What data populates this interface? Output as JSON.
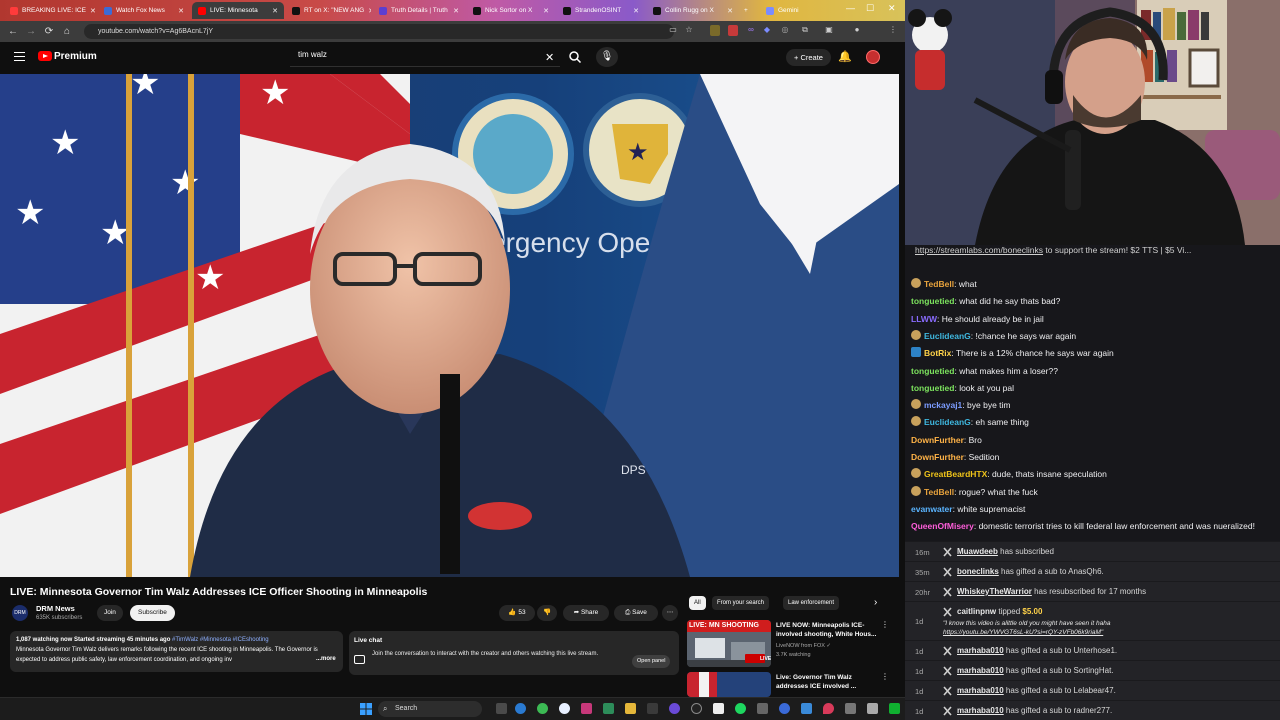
{
  "browser": {
    "tabs": [
      {
        "label": "BREAKING LIVE: ICE",
        "color": "#ff3b3b"
      },
      {
        "label": "Watch Fox News",
        "color": "#3b6bd6"
      },
      {
        "label": "LIVE: Minnesota",
        "color": "#ff0000"
      },
      {
        "label": "RT on X: \"NEW ANG",
        "color": "#000000"
      },
      {
        "label": "Truth Details | Truth",
        "color": "#5b3fd1"
      },
      {
        "label": "Nick Sortor on X",
        "color": "#000000"
      },
      {
        "label": "StrandenOSINT",
        "color": "#000000"
      },
      {
        "label": "Collin Rugg on X",
        "color": "#000000"
      },
      {
        "label": "Gemini",
        "color": "#7a8cff"
      }
    ],
    "new_tab": "+",
    "window_controls": {
      "minimize": "—",
      "maximize": "☐",
      "close": "✕"
    },
    "url": "youtube.com/watch?v=Ag6BAcnL7jY",
    "nav": {
      "back": "←",
      "forward": "→",
      "reload": "⟳"
    }
  },
  "youtube": {
    "brand": "Premium",
    "search_query": "tim walz",
    "search_clear": "✕",
    "create_label": "+ Create",
    "bell": "🔔",
    "mic": "🎤",
    "video": {
      "title": "LIVE: Minnesota Governor Tim Walz Addresses ICE Officer Shooting in Minneapolis",
      "backdrop_seal_text": "ergency Ope",
      "jacket_text": "DPS"
    },
    "channel": {
      "name": "DRM News",
      "subscribers": "635K subscribers",
      "avatar_text": "DRM",
      "join_label": "Join",
      "subscribe_label": "Subscribe"
    },
    "actions": {
      "likes": "53",
      "share": "Share",
      "save": "Save",
      "more": "⋯"
    },
    "description": {
      "stats": "1,087 watching now  Started streaming 45 minutes ago",
      "tags": "#TimWalz #Minnesota #ICEshooting",
      "text": "Minnesota Governor Tim Walz delivers remarks following the recent ICE shooting in Minneapolis. The Governor is expected to address public safety, law enforcement coordination, and ongoing inv",
      "more": "...more"
    },
    "live_chat": {
      "title": "Live chat",
      "message": "Join the conversation to interact with the creator and others watching this live stream.",
      "open_panel": "Open panel"
    },
    "chips": [
      "All",
      "From your search",
      "Law enforcement",
      "›"
    ],
    "recommendations": [
      {
        "badge": "LIVE: MN SHOOTING",
        "live_tag": "LIVE",
        "title": "LIVE NOW: Minneapolis ICE-involved shooting, White Hous...",
        "channel": "LiveNOW from FOX ✓",
        "meta": "3.7K watching"
      },
      {
        "title": "Live: Governor Tim Walz addresses ICE involved ...",
        "channel": ""
      }
    ]
  },
  "chat": {
    "banner_link": "https://streamlabs.com/boneclinks",
    "banner_text": " to support the stream! $2 TTS | $5 Vi...",
    "messages": [
      {
        "user": "TedBell",
        "color": "#e8a33d",
        "text": "what",
        "badge": "sub"
      },
      {
        "user": "tonguetied",
        "color": "#7ce35e",
        "text": "what did he say thats bad?",
        "badge": ""
      },
      {
        "user": "LLWW",
        "color": "#8a6cff",
        "text": "He should already be in jail",
        "badge": ""
      },
      {
        "user": "EuclideanG",
        "color": "#3fb8e0",
        "text": "!chance he says war again",
        "badge": "sub"
      },
      {
        "user": "BotRix",
        "color": "#ffd34a",
        "text": "There is a 12% chance he says war again",
        "badge": "robot"
      },
      {
        "user": "tonguetied",
        "color": "#7ce35e",
        "text": "what makes him a loser??",
        "badge": ""
      },
      {
        "user": "tonguetied",
        "color": "#7ce35e",
        "text": "look at you pal",
        "badge": ""
      },
      {
        "user": "mckayaj1",
        "color": "#7c9cff",
        "text": "bye bye tim",
        "badge": "sub"
      },
      {
        "user": "EuclideanG",
        "color": "#3fb8e0",
        "text": "eh same thing",
        "badge": "sub"
      },
      {
        "user": "DownFurther",
        "color": "#ffb347",
        "text": "Bro",
        "badge": ""
      },
      {
        "user": "DownFurther",
        "color": "#ffb347",
        "text": "Sedition",
        "badge": ""
      },
      {
        "user": "GreatBeardHTX",
        "color": "#f0c419",
        "text": "dude, thats insane speculation",
        "badge": "sub"
      },
      {
        "user": "TedBell",
        "color": "#e8a33d",
        "text": "rogue? what the fuck",
        "badge": "sub"
      },
      {
        "user": "evanwater",
        "color": "#5ab4ff",
        "text": "white supremacist",
        "badge": ""
      },
      {
        "user": "QueenOfMisery",
        "color": "#ff5edb",
        "text": "domestic terrorist tries to kill federal law enforcement and was nueralized!",
        "badge": ""
      }
    ]
  },
  "events": [
    {
      "time": "16m",
      "user": "Muawdeeb",
      "text": " has subscribed"
    },
    {
      "time": "35m",
      "user": "boneclinks",
      "text": " has gifted a sub to AnasQh6."
    },
    {
      "time": "20hr",
      "user": "WhiskeyTheWarrior",
      "text": " has resubscribed for 17 months"
    },
    {
      "time": "1d",
      "user": "caitlinpnw",
      "text": " tipped ",
      "amount": "$5.00",
      "quote": "\"I know this video is alittle old you might have seen it haha",
      "quote_link": "https://youtu.be/YWVGT6sL-kU?si=rQY-zVFb06k9riaM\""
    },
    {
      "time": "1d",
      "user": "marhaba010",
      "text": " has gifted a sub to Unterhose1."
    },
    {
      "time": "1d",
      "user": "marhaba010",
      "text": " has gifted a sub to SortingHat."
    },
    {
      "time": "1d",
      "user": "marhaba010",
      "text": " has gifted a sub to Lelabear47."
    },
    {
      "time": "1d",
      "user": "marhaba010",
      "text": " has gifted a sub to radner277."
    }
  ],
  "taskbar": {
    "search_placeholder": "Search"
  }
}
